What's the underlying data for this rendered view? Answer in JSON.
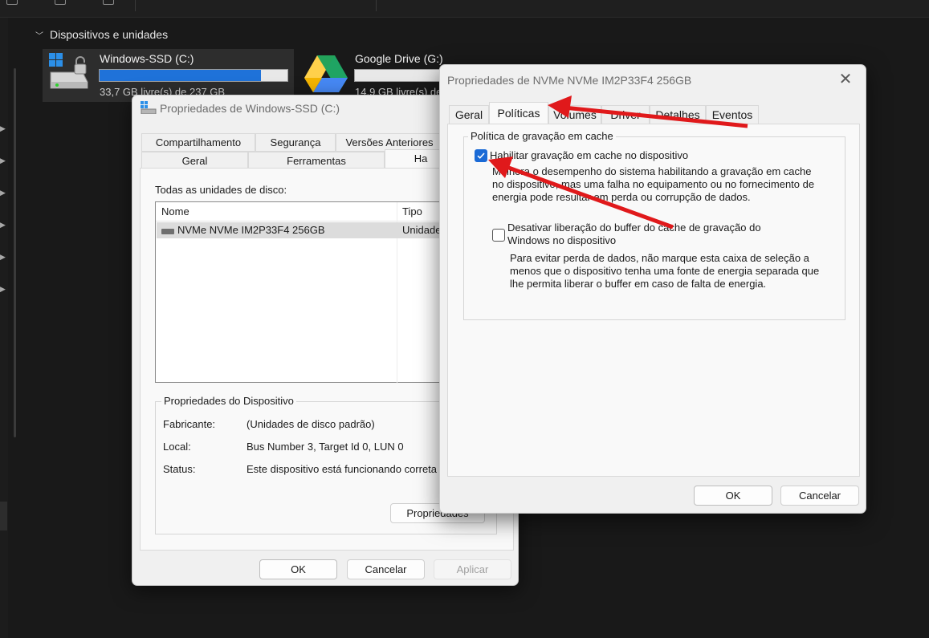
{
  "explorer": {
    "section_title": "Dispositivos e unidades",
    "drive_c": {
      "name": "Windows-SSD (C:)",
      "free_text": "33,7 GB livre(s) de 237 GB",
      "used_fraction": 0.86
    },
    "drive_g": {
      "name": "Google Drive (G:)",
      "free_text": "14,9 GB livre(s) de"
    }
  },
  "dialog_ssd": {
    "title": "Propriedades de Windows-SSD (C:)",
    "tabs_row1": [
      "Compartilhamento",
      "Segurança",
      "Versões Anteriores"
    ],
    "tabs_row2": [
      "Geral",
      "Ferramentas",
      "Ha"
    ],
    "all_disks_label": "Todas as unidades de disco:",
    "list_headers": {
      "name": "Nome",
      "type": "Tipo"
    },
    "list_row": {
      "name": "NVMe NVMe IM2P33F4 256GB",
      "type": "Unidade"
    },
    "device_props_title": "Propriedades do Dispositivo",
    "manufacturer_key": "Fabricante:",
    "manufacturer_val": "(Unidades de disco padrão)",
    "location_key": "Local:",
    "location_val": "Bus Number 3, Target Id 0, LUN 0",
    "status_key": "Status:",
    "status_val": "Este dispositivo está funcionando correta",
    "properties_button": "Propriedades",
    "ok": "OK",
    "cancel": "Cancelar",
    "apply": "Aplicar"
  },
  "dialog_nvme": {
    "title": "Propriedades de NVMe NVMe IM2P33F4 256GB",
    "tabs": [
      "Geral",
      "Políticas",
      "Volumes",
      "Driver",
      "Detalhes",
      "Eventos"
    ],
    "policy_title": "Política de gravação em cache",
    "enable_cache_label": "Habilitar gravação em cache no dispositivo",
    "enable_cache_checked": true,
    "enable_cache_desc": [
      "Melhora o desempenho do sistema habilitando a gravação em cache",
      "no dispositivo, mas uma falha no equipamento ou no fornecimento de",
      "energia pode resultar em perda ou corrupção de dados."
    ],
    "disable_flush_label": [
      "Desativar liberação do buffer do cache de gravação do",
      "Windows no dispositivo"
    ],
    "disable_flush_checked": false,
    "disable_flush_desc": [
      "Para evitar perda de dados, não marque esta caixa de seleção a",
      "menos que o dispositivo tenha uma fonte de energia separada que",
      "lhe permita liberar o buffer em caso de falta de energia."
    ],
    "ok": "OK",
    "cancel": "Cancelar"
  },
  "colors": {
    "accent": "#1a6ad6",
    "arrow": "#e0191b",
    "progress": "#1f72d9"
  }
}
